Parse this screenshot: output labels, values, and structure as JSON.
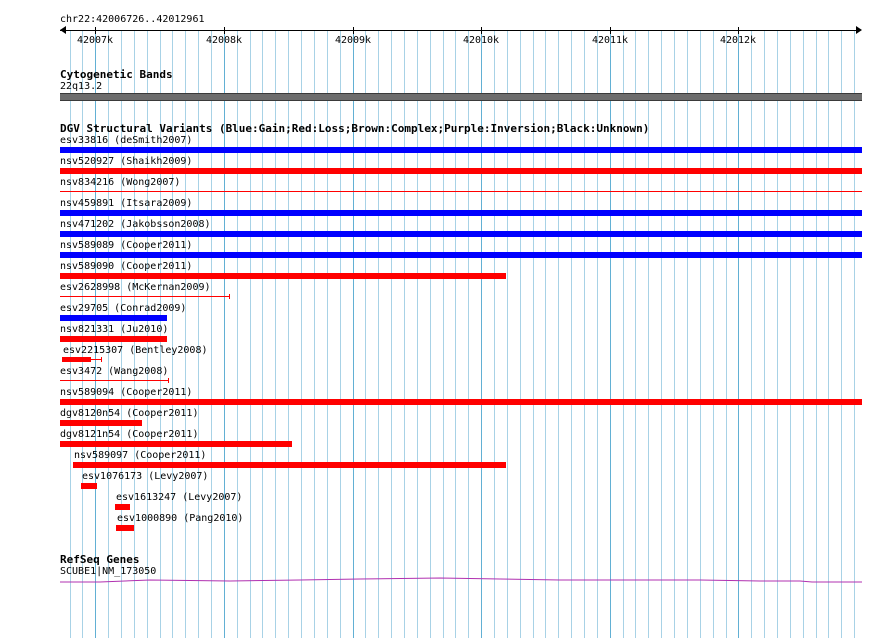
{
  "ruler": {
    "location": "chr22:42006726..42012961",
    "ticks": [
      "42007k",
      "42008k",
      "42009k",
      "42010k",
      "42011k",
      "42012k"
    ]
  },
  "cytoband": {
    "title": "Cytogenetic Bands",
    "band": "22q13.2",
    "color": "#6d6d6d"
  },
  "dgv": {
    "title": "DGV Structural Variants (Blue:Gain;Red:Loss;Brown:Complex;Purple:Inversion;Black:Unknown)",
    "colors": {
      "gain": "#0000ff",
      "loss": "#ff0000"
    },
    "variants": [
      {
        "label": "esv33816 (deSmith2007)",
        "type": "gain",
        "start": 42006726,
        "end": 42012961,
        "style": "thick"
      },
      {
        "label": "nsv520927 (Shaikh2009)",
        "type": "loss",
        "start": 42006726,
        "end": 42012961,
        "style": "thick"
      },
      {
        "label": "nsv834216 (Wong2007)",
        "type": "loss",
        "start": 42006726,
        "end": 42012961,
        "style": "thin"
      },
      {
        "label": "nsv459891 (Itsara2009)",
        "type": "gain",
        "start": 42006726,
        "end": 42012961,
        "style": "thick"
      },
      {
        "label": "nsv471202 (Jakobsson2008)",
        "type": "gain",
        "start": 42006726,
        "end": 42012961,
        "style": "thick"
      },
      {
        "label": "nsv589089 (Cooper2011)",
        "type": "gain",
        "start": 42006726,
        "end": 42012961,
        "style": "thick"
      },
      {
        "label": "nsv589090 (Cooper2011)",
        "type": "loss",
        "start": 42006726,
        "end": 42010190,
        "style": "thick"
      },
      {
        "label": "esv2628998 (McKernan2009)",
        "type": "loss",
        "start": 42006726,
        "end": 42008045,
        "style": "thin"
      },
      {
        "label": "esv29705 (Conrad2009)",
        "type": "gain",
        "start": 42006726,
        "end": 42007560,
        "style": "thick"
      },
      {
        "label": "nsv821331 (Ju2010)",
        "type": "loss",
        "start": 42006726,
        "end": 42007560,
        "style": "thick"
      },
      {
        "label": "esv2215307 (Bentley2008)",
        "type": "loss",
        "start": 42006740,
        "end": 42007050,
        "style": "thick-with-tail",
        "tail_end": 42007050,
        "thick_end": 42006970
      },
      {
        "label": "esv3472 (Wang2008)",
        "type": "loss",
        "start": 42006726,
        "end": 42007570,
        "style": "thin"
      },
      {
        "label": "nsv589094 (Cooper2011)",
        "type": "loss",
        "start": 42006726,
        "end": 42012961,
        "style": "thick"
      },
      {
        "label": "dgv8120n54 (Cooper2011)",
        "type": "loss",
        "start": 42006726,
        "end": 42007360,
        "style": "thick"
      },
      {
        "label": "dgv8121n54 (Cooper2011)",
        "type": "loss",
        "start": 42006726,
        "end": 42008530,
        "style": "thick"
      },
      {
        "label": "nsv589097 (Cooper2011)",
        "type": "loss",
        "start": 42006830,
        "end": 42010190,
        "style": "thick"
      },
      {
        "label": "esv1076173 (Levy2007)",
        "type": "loss",
        "start": 42006890,
        "end": 42007010,
        "style": "thick"
      },
      {
        "label": "esv1613247 (Levy2007)",
        "type": "loss",
        "start": 42007150,
        "end": 42007270,
        "style": "thick"
      },
      {
        "label": "esv1000890 (Pang2010)",
        "type": "loss",
        "start": 42007160,
        "end": 42007300,
        "style": "thick"
      }
    ]
  },
  "refseq": {
    "title": "RefSeq Genes",
    "gene": "SCUBE1|NM_173050",
    "color": "#b030b0"
  }
}
